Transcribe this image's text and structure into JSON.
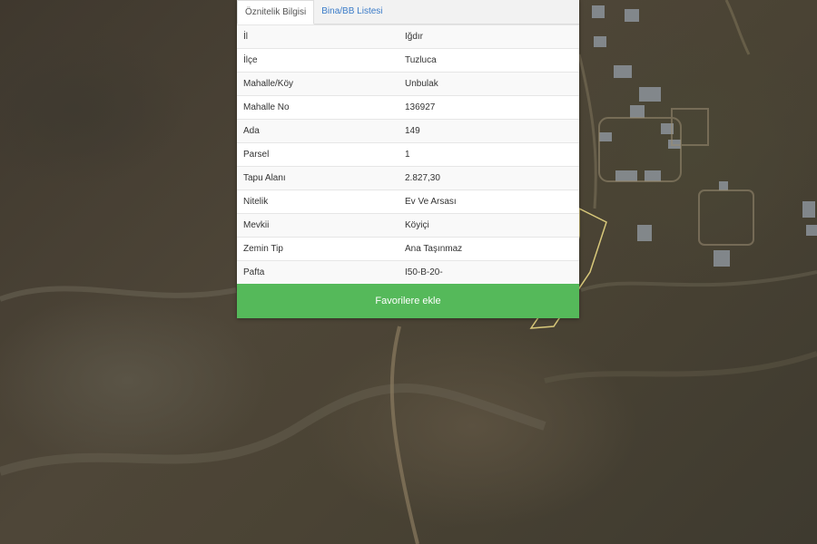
{
  "tabs": [
    {
      "label": "Öznitelik Bilgisi"
    },
    {
      "label": "Bina/BB Listesi"
    }
  ],
  "attributes": [
    {
      "key": "İl",
      "value": "Iğdır"
    },
    {
      "key": "İlçe",
      "value": "Tuzluca"
    },
    {
      "key": "Mahalle/Köy",
      "value": "Unbulak"
    },
    {
      "key": "Mahalle No",
      "value": "136927"
    },
    {
      "key": "Ada",
      "value": "149"
    },
    {
      "key": "Parsel",
      "value": "1"
    },
    {
      "key": "Tapu Alanı",
      "value": "2.827,30"
    },
    {
      "key": "Nitelik",
      "value": "Ev Ve Arsası"
    },
    {
      "key": "Mevkii",
      "value": "Köyiçi"
    },
    {
      "key": "Zemin Tip",
      "value": "Ana Taşınmaz"
    },
    {
      "key": "Pafta",
      "value": "I50-B-20-"
    }
  ],
  "actions": {
    "favorite_label": "Favorilere ekle"
  },
  "colors": {
    "button": "#55b95a",
    "tab_link": "#3a7bc8",
    "parcel_outline": "#d8c87a"
  }
}
